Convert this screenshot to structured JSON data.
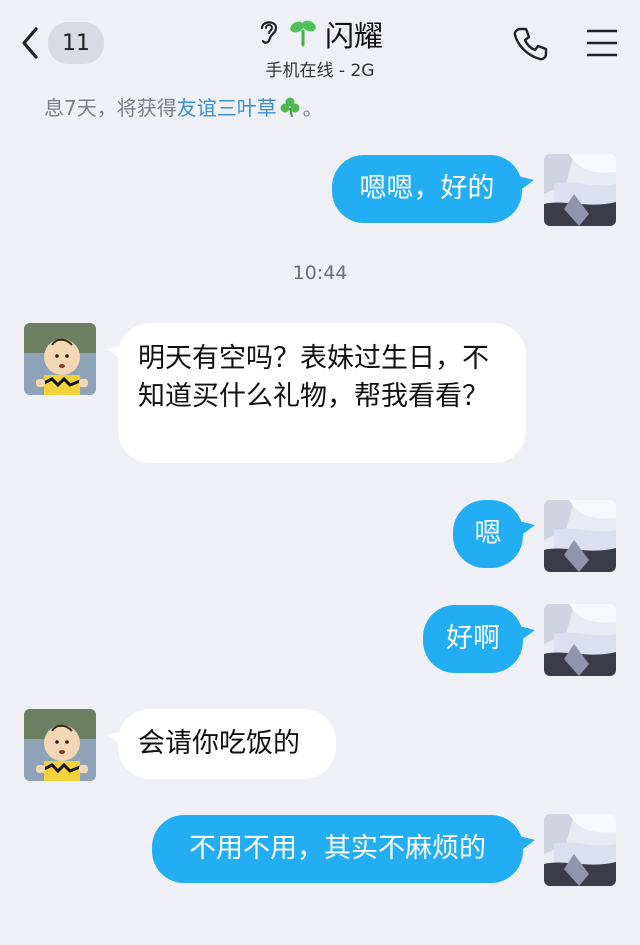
{
  "header": {
    "unread_count": "11",
    "contact_name": "闪耀",
    "status": "手机在线 - 2G"
  },
  "icons": {
    "back": "chevron-left-icon",
    "ear": "ear-icon",
    "sprout": "sprout-icon",
    "phone": "phone-icon",
    "menu": "hamburger-menu-icon",
    "clover": "clover-icon"
  },
  "tip": {
    "prefix": "息7天，将获得",
    "link": "友谊三叶草",
    "suffix": "。"
  },
  "timestamp": "10:44",
  "messages": [
    {
      "side": "out",
      "text": "嗯嗯，好的"
    },
    {
      "side": "in",
      "text": "明天有空吗？表妹过生日，不知道买什么礼物，帮我看看？"
    },
    {
      "side": "out",
      "text": "嗯"
    },
    {
      "side": "out",
      "text": "好啊"
    },
    {
      "side": "in",
      "text": "会请你吃饭的"
    },
    {
      "side": "out",
      "text": "不用不用，其实不麻烦的"
    }
  ],
  "colors": {
    "background": "#eef0f6",
    "outgoing_bubble": "#23aef3",
    "incoming_bubble": "#ffffff",
    "link": "#3c8fd6"
  }
}
